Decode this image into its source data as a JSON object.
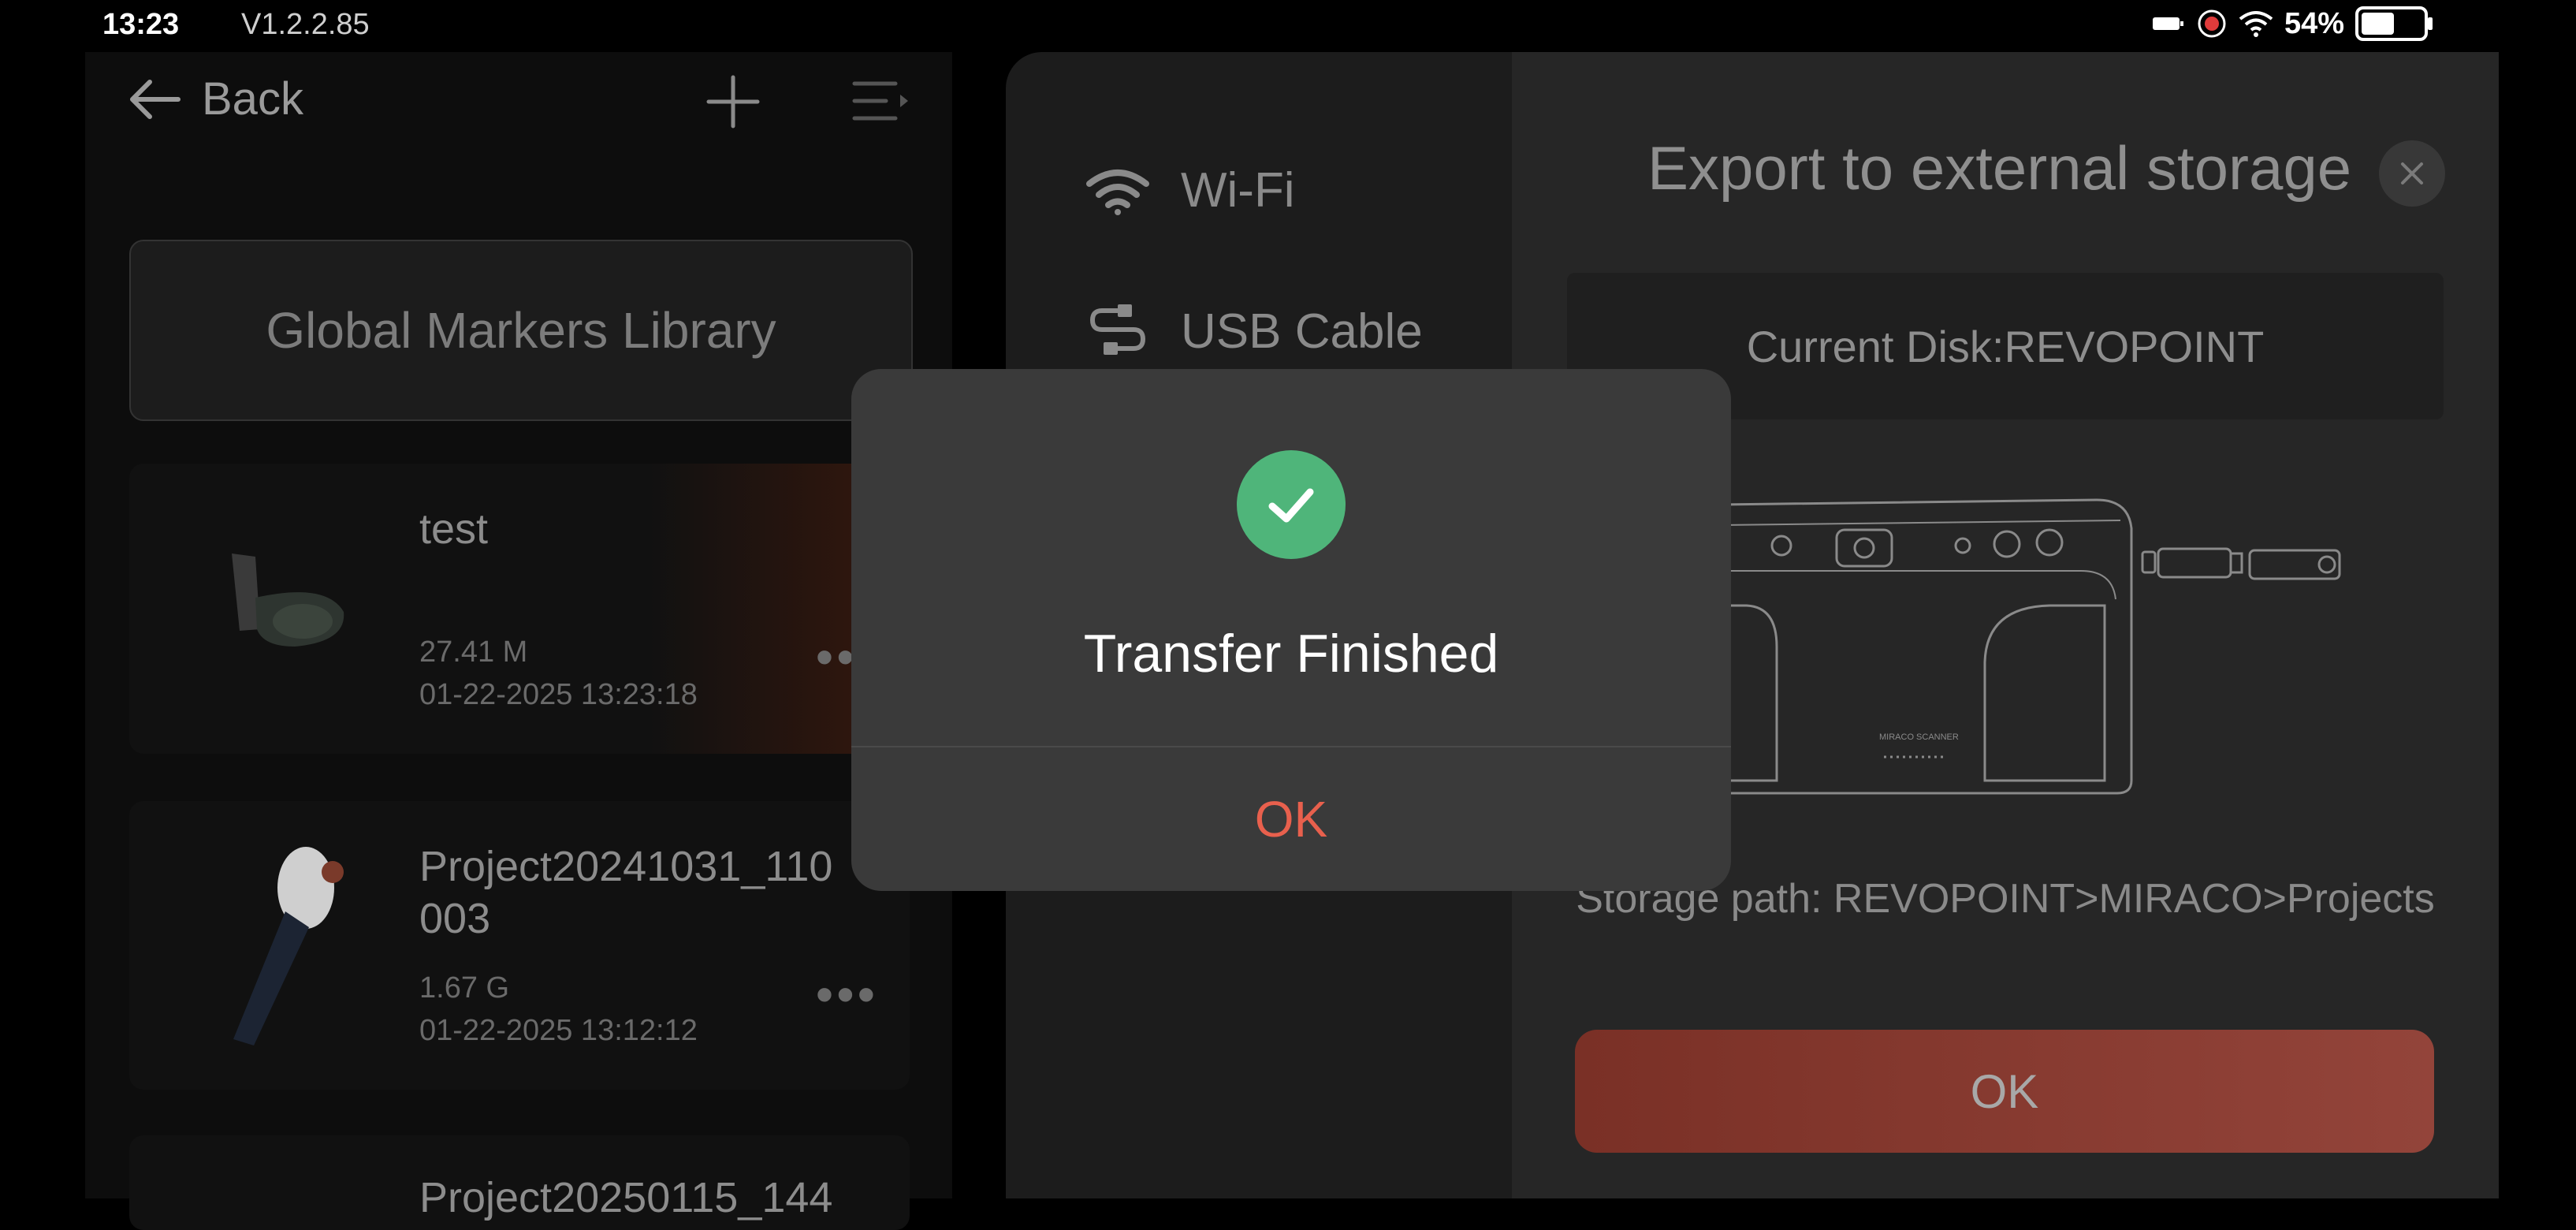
{
  "status_bar": {
    "time": "13:23",
    "version": "V1.2.2.85",
    "battery_percent": "54%",
    "battery_level": 0.54
  },
  "left_panel": {
    "back_label": "Back",
    "global_markers_label": "Global Markers Library",
    "projects": [
      {
        "name": "test",
        "size": "27.41 M",
        "date": "01-22-2025 13:23:18"
      },
      {
        "name": "Project20241031_110\n003",
        "size": "1.67 G",
        "date": "01-22-2025 13:12:12"
      },
      {
        "name": "Project20250115_144"
      }
    ]
  },
  "export_panel": {
    "options": [
      {
        "label": "Wi-Fi",
        "icon": "wifi-icon"
      },
      {
        "label": "USB Cable",
        "icon": "usb-cable-icon"
      }
    ],
    "title": "Export to external storage",
    "current_disk": "Current Disk:REVOPOINT",
    "device_label": "MIRACO SCANNER",
    "storage_path": "Storage path: REVOPOINT>MIRACO>Projects",
    "ok_label": "OK"
  },
  "modal": {
    "icon": "check-circle-icon",
    "title": "Transfer Finished",
    "ok_label": "OK"
  },
  "colors": {
    "accent_red": "#e8604d",
    "success_green": "#4fb57a",
    "button_red": "#93443a"
  }
}
